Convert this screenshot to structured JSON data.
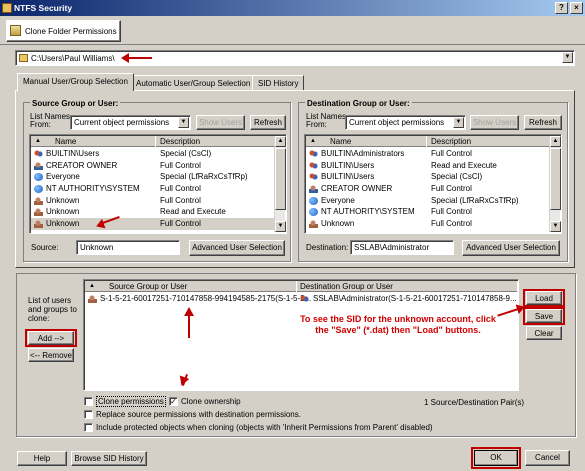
{
  "window": {
    "title": "NTFS Security"
  },
  "toolbar": {
    "clone_tab_label": "Clone Folder Permissions"
  },
  "path": {
    "value": "C:\\Users\\Paul Williams\\"
  },
  "tabs": [
    {
      "label": "Manual User/Group Selection",
      "active": true
    },
    {
      "label": "Automatic User/Group Selection",
      "active": false
    },
    {
      "label": "SID History",
      "active": false
    }
  ],
  "source": {
    "group_title": "Source Group or User:",
    "list_names_label": "List Names",
    "from_label": "From:",
    "list_from_value": "Current object permissions",
    "show_users_label": "Show Users",
    "refresh_label": "Refresh",
    "col_name": "Name",
    "col_description": "Description",
    "rows": [
      {
        "name": "BUILTIN\\Users",
        "description": "Special (CsCl)",
        "icon": "group-icon"
      },
      {
        "name": "CREATOR OWNER",
        "description": "Full Control",
        "icon": "user-icon"
      },
      {
        "name": "Everyone",
        "description": "Special (LfRaRxCsTfRp)",
        "icon": "globe-icon"
      },
      {
        "name": "NT AUTHORITY\\SYSTEM",
        "description": "Full Control",
        "icon": "globe-icon"
      },
      {
        "name": "Unknown",
        "description": "Full Control",
        "icon": "unknown-user-icon"
      },
      {
        "name": "Unknown",
        "description": "Read and Execute",
        "icon": "unknown-user-icon"
      },
      {
        "name": "Unknown",
        "description": "Full Control",
        "icon": "unknown-user-icon",
        "selected": true
      }
    ],
    "source_label": "Source:",
    "source_value": "Unknown",
    "advanced_label": "Advanced User Selection"
  },
  "destination": {
    "group_title": "Destination Group or User:",
    "list_names_label": "List Names",
    "from_label": "From:",
    "list_from_value": "Current object permissions",
    "show_users_label": "Show Users",
    "refresh_label": "Refresh",
    "col_name": "Name",
    "col_description": "Description",
    "rows": [
      {
        "name": "BUILTIN\\Administrators",
        "description": "Full Control",
        "icon": "group-icon"
      },
      {
        "name": "BUILTIN\\Users",
        "description": "Read and Execute",
        "icon": "group-icon"
      },
      {
        "name": "BUILTIN\\Users",
        "description": "Special (CsCl)",
        "icon": "group-icon"
      },
      {
        "name": "CREATOR OWNER",
        "description": "Full Control",
        "icon": "user-icon"
      },
      {
        "name": "Everyone",
        "description": "Special (LfRaRxCsTfRp)",
        "icon": "globe-icon"
      },
      {
        "name": "NT AUTHORITY\\SYSTEM",
        "description": "Full Control",
        "icon": "globe-icon"
      },
      {
        "name": "Unknown",
        "description": "Full Control",
        "icon": "unknown-user-icon"
      }
    ],
    "destination_label": "Destination:",
    "destination_value": "SSLAB\\Administrator",
    "advanced_label": "Advanced User Selection"
  },
  "clone_list": {
    "side_label": "List of users and groups to clone:",
    "add_label": "Add -->",
    "remove_label": "<-- Remove",
    "col_source": "Source Group or User",
    "col_destination": "Destination Group or User",
    "rows": [
      {
        "source": "S-1-5-21-60017251-710147858-994194585-2175(S-1-5-2...",
        "destination": "SSLAB\\Administrator(S-1-5-21-60017251-710147858-9..."
      }
    ],
    "load_label": "Load",
    "save_label": "Save",
    "clear_label": "Clear",
    "annotation": "To see the SID for the unknown account, click the \"Save\" (*.dat) then \"Load\" buttons.",
    "pair_count": "1 Source/Destination Pair(s)"
  },
  "options": {
    "clone_permissions": {
      "label": "Clone permissions",
      "checked": false
    },
    "clone_ownership": {
      "label": "Clone ownership",
      "checked": true
    },
    "replace_source": {
      "label": "Replace source permissions with destination permissions.",
      "checked": false
    },
    "include_protected": {
      "label": "Include protected objects when cloning (objects with 'Inherit Permissions from Parent' disabled)",
      "checked": false
    }
  },
  "footer": {
    "help_label": "Help",
    "browse_sid_label": "Browse SID History",
    "ok_label": "OK",
    "cancel_label": "Cancel"
  },
  "colors": {
    "annotation_red": "#c00000",
    "titlebar": "#0a246a"
  }
}
